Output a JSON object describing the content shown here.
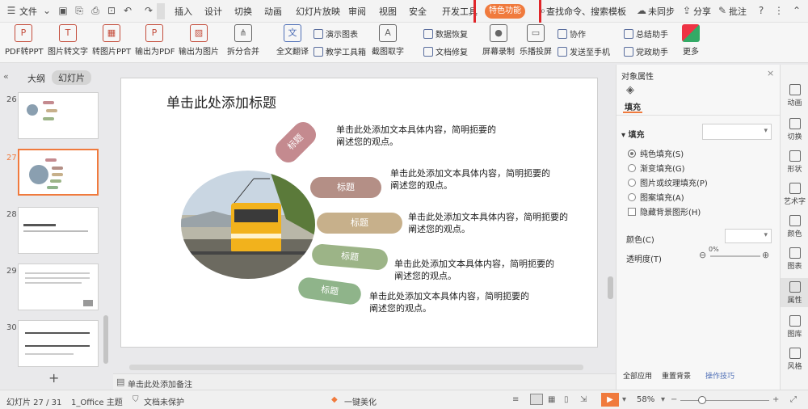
{
  "titlebar": {
    "file_label": "文件",
    "tabs": [
      "插入",
      "设计",
      "切换",
      "动画",
      "幻灯片放映",
      "审阅",
      "视图",
      "安全",
      "开发工具"
    ],
    "special_tab": "特色功能",
    "search_placeholder": "查找命令、搜索模板",
    "sync_label": "未同步",
    "share_label": "分享",
    "annotate_label": "批注"
  },
  "toolbar": {
    "big_tools": [
      "PDF转PPT",
      "图片转文字",
      "转图片PPT",
      "输出为PDF",
      "输出为图片",
      "拆分合并"
    ],
    "mid_tools": [
      "全文翻译",
      "截图取字",
      "屏幕录制",
      "乐播投屏",
      "更多"
    ],
    "small_tools": [
      "演示图表",
      "教学工具箱",
      "数据恢复",
      "文档修复",
      "协作",
      "发送至手机",
      "总结助手",
      "党政助手"
    ]
  },
  "leftpanel": {
    "tab_outline": "大纲",
    "tab_slides": "幻灯片",
    "slide_numbers": [
      "26",
      "27",
      "28",
      "29",
      "30"
    ],
    "add_label": "+",
    "notes_placeholder": "单击此处添加备注"
  },
  "slide": {
    "title": "单击此处添加标题",
    "pills": [
      "标题",
      "标题",
      "标题",
      "标题",
      "标题"
    ],
    "body": "单击此处添加文本具体内容，简明扼要的阐述您的观点。",
    "pill_colors": [
      "#c48a8f",
      "#b48f86",
      "#c7b08b",
      "#9cb487",
      "#8fb48a"
    ]
  },
  "rightpanel": {
    "title": "对象属性",
    "tab_fill": "填充",
    "section_fill": "填充",
    "options": [
      "纯色填充(S)",
      "渐变填充(G)",
      "图片或纹理填充(P)",
      "图案填充(A)"
    ],
    "hide_bg": "隐藏背景图形(H)",
    "color_label": "颜色(C)",
    "transparency_label": "透明度(T)",
    "transparency_value": "0%",
    "apply_all": "全部应用",
    "reset_bg": "重置背景",
    "tips": "操作技巧"
  },
  "sidebar": {
    "items": [
      "动画",
      "切换",
      "形状",
      "艺术字",
      "颜色",
      "图表",
      "属性",
      "图库",
      "风格"
    ]
  },
  "statusbar": {
    "slide_info": "幻灯片 27 / 31",
    "theme": "1_Office 主题",
    "protect": "文档未保护",
    "beautify": "一键美化",
    "zoom": "58%"
  },
  "colors": {
    "accent_orange": "#f07a3d",
    "highlight_red": "#e0262a"
  }
}
